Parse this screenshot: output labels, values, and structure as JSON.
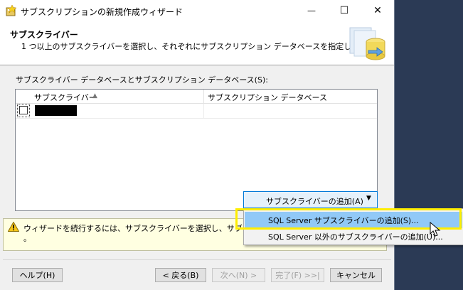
{
  "window": {
    "title": "サブスクリプションの新規作成ウィザード",
    "minimize_glyph": "—",
    "maximize_glyph": "☐",
    "close_glyph": "✕"
  },
  "header": {
    "title": "サブスクライバー",
    "description": "1 つ以上のサブスクライバーを選択し、それぞれにサブスクリプション データベースを指定します。"
  },
  "grid": {
    "label": "サブスクライバー データベースとサブスクリプション データベース(S):",
    "columns": [
      "サブスクライバー",
      "サブスクリプション データベース"
    ],
    "sort_glyph": "▲"
  },
  "add_subscriber": {
    "label": "サブスクライバーの追加(A)",
    "arrow": "▼"
  },
  "menu": {
    "items": [
      "SQL Server サブスクライバーの追加(S)...",
      "SQL Server 以外のサブスクライバーの追加(U)..."
    ]
  },
  "warning": {
    "text": "ウィザードを続行するには、サブスクライバーを選択し、サブスクリプ",
    "text_line2": "。"
  },
  "buttons": {
    "help": "ヘルプ(H)",
    "back": "< 戻る(B)",
    "next": "次へ(N) >",
    "finish": "完了(F) >>|",
    "cancel": "キャンセル"
  },
  "colors": {
    "accent": "#0078d7",
    "menu_hover": "#91c9f7",
    "highlight": "#ffee00",
    "warning_bg": "#ffffe1"
  }
}
